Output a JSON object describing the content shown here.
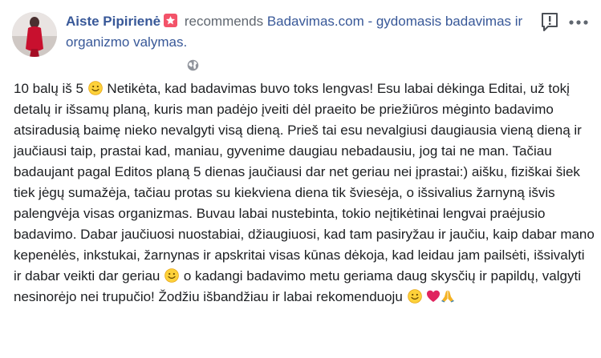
{
  "post": {
    "author": "Aiste Pipirienė",
    "action": " recommends ",
    "page": "Badavimas.com - gydomasis badavimas ir organizmo valymas."
  },
  "icons": {
    "badge": "gem-badge-icon",
    "report": "report-flag-icon",
    "more": "more-options-icon",
    "privacy": "public-globe-icon"
  },
  "colors": {
    "author": "#385898",
    "body_text": "#1c1e21",
    "badge": "#f35369"
  },
  "review": {
    "s1": "10 balų iš 5 ",
    "s2": " Netikėta, kad badavimas buvo toks lengvas! Esu labai dėkinga Editai, už tokį detalų ir išsamų planą, kuris man padėjo įveiti dėl praeito be priežiūros mėginto badavimo atsiradusią baimę nieko nevalgyti visą dieną. Prieš tai esu nevalgiusi daugiausia vieną dieną ir jaučiausi taip, prastai kad, maniau, gyvenime daugiau nebadausiu, jog tai ne man. Tačiau badaujant pagal Editos planą 5 dienas jaučiausi dar net geriau nei įprastai:) aišku, fiziškai šiek tiek jėgų sumažėja, tačiau protas su kiekviena diena tik šviesėja, o išsivalius žarnyną išvis palengvėja visas organizmas. Buvau labai nustebinta, tokio neįtikėtinai lengvai praėjusio badavimo. Dabar jaučiuosi nuostabiai, džiaugiuosi, kad tam pasiryžau ir jaučiu, kaip dabar mano kepenėlės, inkstukai, žarnynas ir apskritai visas kūnas dėkoja, kad leidau jam pailsėti, išsivalyti ir dabar veikti dar geriau ",
    "s3": " o kadangi badavimo metu geriama daug skysčių ir papildų, valgyti nesinorėjo nei trupučio! Žodžiu išbandžiau ir labai rekomenduoju ",
    "emojis": [
      "smile-emoji",
      "smile-emoji",
      "smile-emoji",
      "red-heart-emoji",
      "folded-hands-emoji"
    ]
  }
}
